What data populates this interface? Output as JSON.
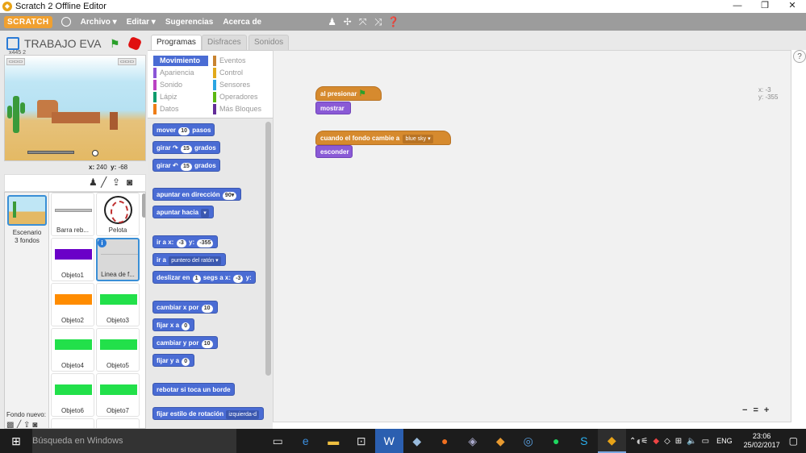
{
  "window": {
    "title": "Scratch 2 Offline Editor",
    "controls": {
      "minimize": "—",
      "maximize": "❐",
      "close": "✕"
    }
  },
  "menubar": {
    "logo": "SCRATCH",
    "items": [
      "Archivo ▾",
      "Editar ▾",
      "Sugerencias",
      "Acerca de"
    ],
    "tool_icons": [
      "stamp-icon",
      "cut-icon",
      "grow-icon",
      "shrink-icon",
      "help-icon"
    ]
  },
  "stage": {
    "project_name": "TRABAJO EVA",
    "mouse_x_label": "x:",
    "mouse_x": "240",
    "mouse_y_label": "y:",
    "mouse_y": "-68",
    "pos_note": "x445 2"
  },
  "sprite_pane": {
    "scenario_label": "Escenario",
    "scenario_count": "3 fondos",
    "new_backdrop": "Fondo nuevo:",
    "sprites": [
      {
        "name": "Barra reb...",
        "swatch": "#c0c0c0",
        "kind": "bar"
      },
      {
        "name": "Pelota",
        "swatch": "",
        "kind": "ball"
      },
      {
        "name": "Objeto1",
        "swatch": "#6a00c8",
        "kind": "swatch"
      },
      {
        "name": "Linea de f...",
        "swatch": "#d0d0d0",
        "kind": "selected"
      },
      {
        "name": "Objeto2",
        "swatch": "#ff8c00",
        "kind": "swatch"
      },
      {
        "name": "Objeto3",
        "swatch": "#22e04a",
        "kind": "swatch"
      },
      {
        "name": "Objeto4",
        "swatch": "#22e04a",
        "kind": "swatch"
      },
      {
        "name": "Objeto5",
        "swatch": "#22e04a",
        "kind": "swatch"
      },
      {
        "name": "Objeto6",
        "swatch": "#22e04a",
        "kind": "swatch"
      },
      {
        "name": "Objeto7",
        "swatch": "#22e04a",
        "kind": "swatch"
      }
    ]
  },
  "tabs": [
    "Programas",
    "Disfraces",
    "Sonidos"
  ],
  "categories": [
    {
      "label": "Movimiento",
      "color": "#4a6cd4"
    },
    {
      "label": "Eventos",
      "color": "#c88330"
    },
    {
      "label": "Apariencia",
      "color": "#8a55d7"
    },
    {
      "label": "Control",
      "color": "#e1a91a"
    },
    {
      "label": "Sonido",
      "color": "#bb42c3"
    },
    {
      "label": "Sensores",
      "color": "#2ca5e2"
    },
    {
      "label": "Lápiz",
      "color": "#0e9a6c"
    },
    {
      "label": "Operadores",
      "color": "#5cb712"
    },
    {
      "label": "Datos",
      "color": "#ee7d16"
    },
    {
      "label": "Más Bloques",
      "color": "#632d99"
    }
  ],
  "palette_blocks": {
    "b1": {
      "t1": "mover",
      "v1": "10",
      "t2": "pasos"
    },
    "b2": {
      "t1": "girar ↷",
      "v1": "15",
      "t2": "grados"
    },
    "b3": {
      "t1": "girar ↶",
      "v1": "15",
      "t2": "grados"
    },
    "b4": {
      "t1": "apuntar en dirección",
      "d1": "90▾"
    },
    "b5": {
      "t1": "apuntar hacia",
      "d1": "▾"
    },
    "b6": {
      "t1": "ir a x:",
      "v1": "-3",
      "t2": "y:",
      "v2": "-355"
    },
    "b7": {
      "t1": "ir a",
      "d1": "puntero del ratón ▾"
    },
    "b8": {
      "t1": "deslizar en",
      "v1": "1",
      "t2": "segs a x:",
      "v2": "-3",
      "t3": "y:"
    },
    "b9": {
      "t1": "cambiar x por",
      "v1": "10"
    },
    "b10": {
      "t1": "fijar x a",
      "v1": "0"
    },
    "b11": {
      "t1": "cambiar y por",
      "v1": "10"
    },
    "b12": {
      "t1": "fijar y a",
      "v1": "0"
    },
    "b13": {
      "t1": "rebotar si toca un borde"
    },
    "b14": {
      "t1": "fijar estilo de rotación",
      "d1": "izquierda-d"
    }
  },
  "scripts": {
    "s1_hat": "al presionar",
    "s1_cmd": "mostrar",
    "s2_hat": "cuando el fondo cambie a",
    "s2_dd": "blue sky ▾",
    "s2_cmd": "esconder",
    "xy_x": "x: -3",
    "xy_y": "y: -355",
    "zoom": [
      "−",
      "=",
      "+"
    ]
  },
  "taskbar": {
    "search": "Búsqueda en Windows",
    "lang": "ENG",
    "time": "23:06",
    "date": "25/02/2017"
  }
}
